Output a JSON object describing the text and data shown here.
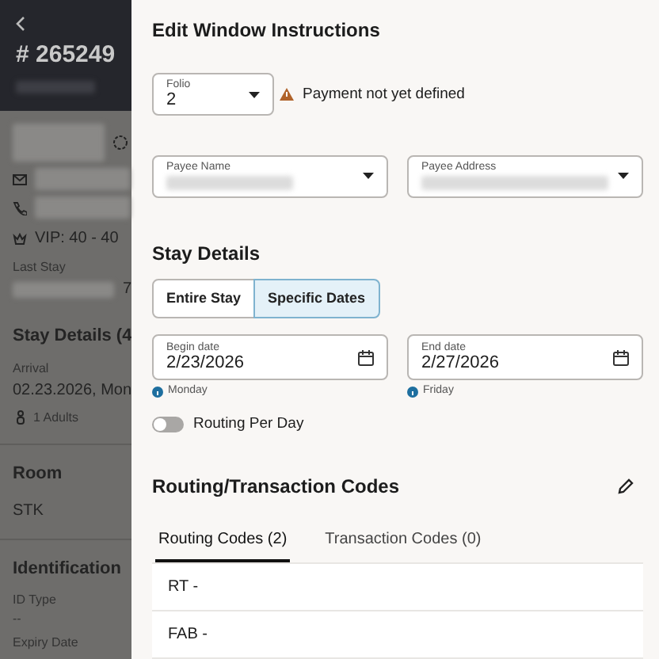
{
  "background_page": {
    "reservation_number": "# 265249",
    "vip": "VIP: 40 - 40",
    "last_stay_label": "Last Stay",
    "last_stay_value": "7",
    "stay_details": {
      "title": "Stay Details (4",
      "arrival_label": "Arrival",
      "arrival_value": "02.23.2026, Mon",
      "guests": "1 Adults"
    },
    "room": {
      "title": "Room",
      "value": "STK"
    },
    "identification": {
      "title": "Identification",
      "id_type_label": "ID Type",
      "id_type_value": "--",
      "expiry_label": "Expiry Date"
    }
  },
  "drawer": {
    "title": "Edit Window Instructions",
    "folio": {
      "label": "Folio",
      "value": "2"
    },
    "warning": "Payment not yet defined",
    "payee_name": {
      "label": "Payee Name"
    },
    "payee_address": {
      "label": "Payee Address"
    },
    "stay_details_title": "Stay Details",
    "stay_options": [
      {
        "label": "Entire Stay",
        "selected": false
      },
      {
        "label": "Specific Dates",
        "selected": true
      }
    ],
    "begin_date": {
      "label": "Begin date",
      "value": "2/23/2026",
      "hint": "Monday"
    },
    "end_date": {
      "label": "End date",
      "value": "2/27/2026",
      "hint": "Friday"
    },
    "routing_per_day": {
      "label": "Routing Per Day",
      "on": false
    },
    "routing_title": "Routing/Transaction Codes",
    "tabs": [
      {
        "label": "Routing Codes (2)",
        "selected": true
      },
      {
        "label": "Transaction Codes (0)",
        "selected": false
      }
    ],
    "codes": [
      "RT -",
      "FAB -"
    ]
  }
}
